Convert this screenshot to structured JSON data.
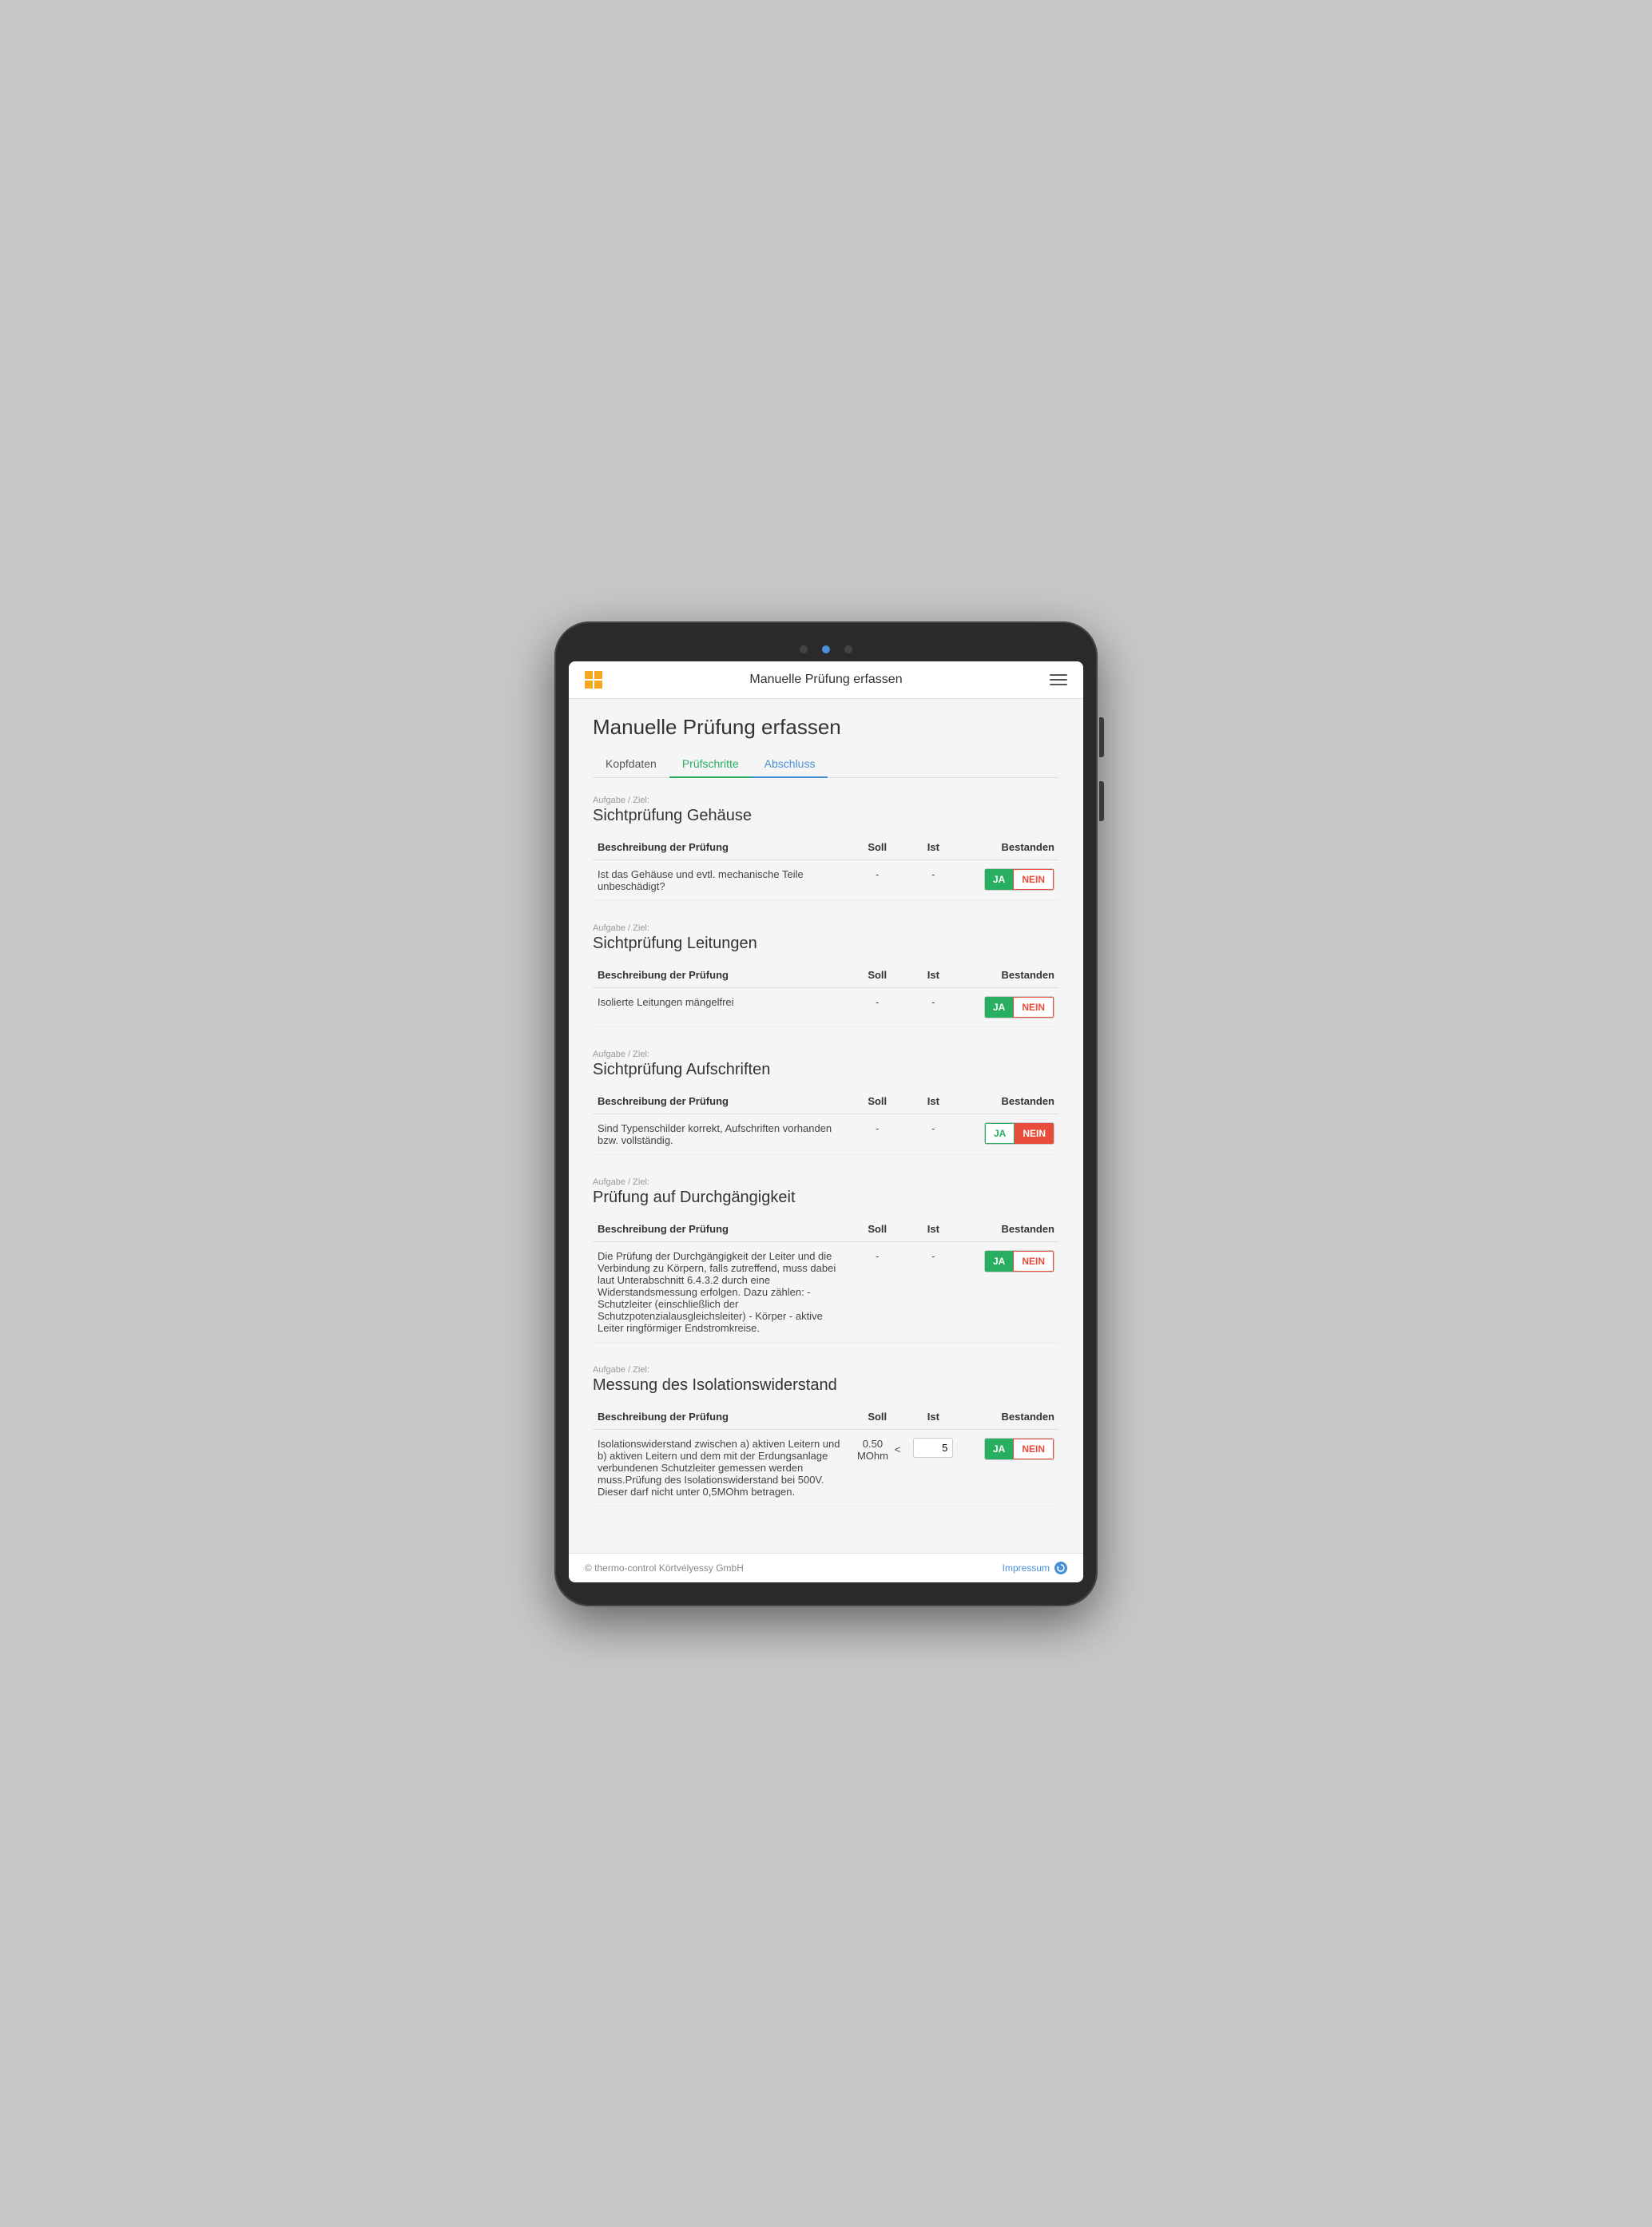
{
  "nav": {
    "title": "Manuelle Prüfung erfassen",
    "menu_label": "menu"
  },
  "page": {
    "title": "Manuelle Prüfung erfassen"
  },
  "tabs": [
    {
      "id": "kopfdaten",
      "label": "Kopfdaten",
      "state": "inactive"
    },
    {
      "id": "pruefschritte",
      "label": "Prüfschritte",
      "state": "active-green"
    },
    {
      "id": "abschluss",
      "label": "Abschluss",
      "state": "active-blue"
    }
  ],
  "sections": [
    {
      "id": "gehaeuse",
      "label": "Aufgabe / Ziel:",
      "title": "Sichtprüfung Gehäuse",
      "col_headers": [
        "Beschreibung der Prüfung",
        "Soll",
        "Ist",
        "Bestanden"
      ],
      "rows": [
        {
          "desc": "Ist das Gehäuse und evtl. mechanische Teile unbeschädigt?",
          "soll": "-",
          "ist": "-",
          "ja_selected": true,
          "nein_selected": false
        }
      ]
    },
    {
      "id": "leitungen",
      "label": "Aufgabe / Ziel:",
      "title": "Sichtprüfung Leitungen",
      "col_headers": [
        "Beschreibung der Prüfung",
        "Soll",
        "Ist",
        "Bestanden"
      ],
      "rows": [
        {
          "desc": "Isolierte Leitungen mängelfrei",
          "soll": "-",
          "ist": "-",
          "ja_selected": true,
          "nein_selected": false
        }
      ]
    },
    {
      "id": "aufschriften",
      "label": "Aufgabe / Ziel:",
      "title": "Sichtprüfung Aufschriften",
      "col_headers": [
        "Beschreibung der Prüfung",
        "Soll",
        "Ist",
        "Bestanden"
      ],
      "rows": [
        {
          "desc": "Sind Typenschilder korrekt, Aufschriften vorhanden bzw. vollständig.",
          "soll": "-",
          "ist": "-",
          "ja_selected": false,
          "nein_selected": true
        }
      ]
    },
    {
      "id": "durchgaengigkeit",
      "label": "Aufgabe / Ziel:",
      "title": "Prüfung auf Durchgängigkeit",
      "col_headers": [
        "Beschreibung der Prüfung",
        "Soll",
        "Ist",
        "Bestanden"
      ],
      "rows": [
        {
          "desc": "Die Prüfung der Durchgängigkeit der Leiter und die Verbindung zu Körpern, falls zutreffend, muss dabei laut Unterabschnitt 6.4.3.2 durch eine Widerstandsmessung erfolgen. Dazu zählen: - Schutzleiter (einschließlich der Schutzpotenzialausgleichsleiter) - Körper - aktive Leiter ringförmiger Endstromkreise.",
          "soll": "-",
          "ist": "-",
          "ja_selected": true,
          "nein_selected": false
        }
      ]
    },
    {
      "id": "isolationswiderstand",
      "label": "Aufgabe / Ziel:",
      "title": "Messung des Isolationswiderstand",
      "col_headers": [
        "Beschreibung der Prüfung",
        "Soll",
        "Ist",
        "Bestanden"
      ],
      "rows": [
        {
          "desc": "Isolationswiderstand zwischen a) aktiven Leitern und b) aktiven Leitern und dem mit der Erdungsanlage verbundenen Schutzleiter gemessen werden muss.Prüfung des Isolationswiderstand bei 500V. Dieser darf nicht unter 0,5MOhm betragen.",
          "soll": "0.50 MOhm",
          "soll_op": "<",
          "ist": "5",
          "ist_input": true,
          "ja_selected": true,
          "nein_selected": false
        }
      ]
    }
  ],
  "footer": {
    "copyright": "© thermo-control Körtvélyessy GmbH",
    "link": "Impressum"
  },
  "buttons": {
    "ja": "JA",
    "nein": "NEIN"
  }
}
